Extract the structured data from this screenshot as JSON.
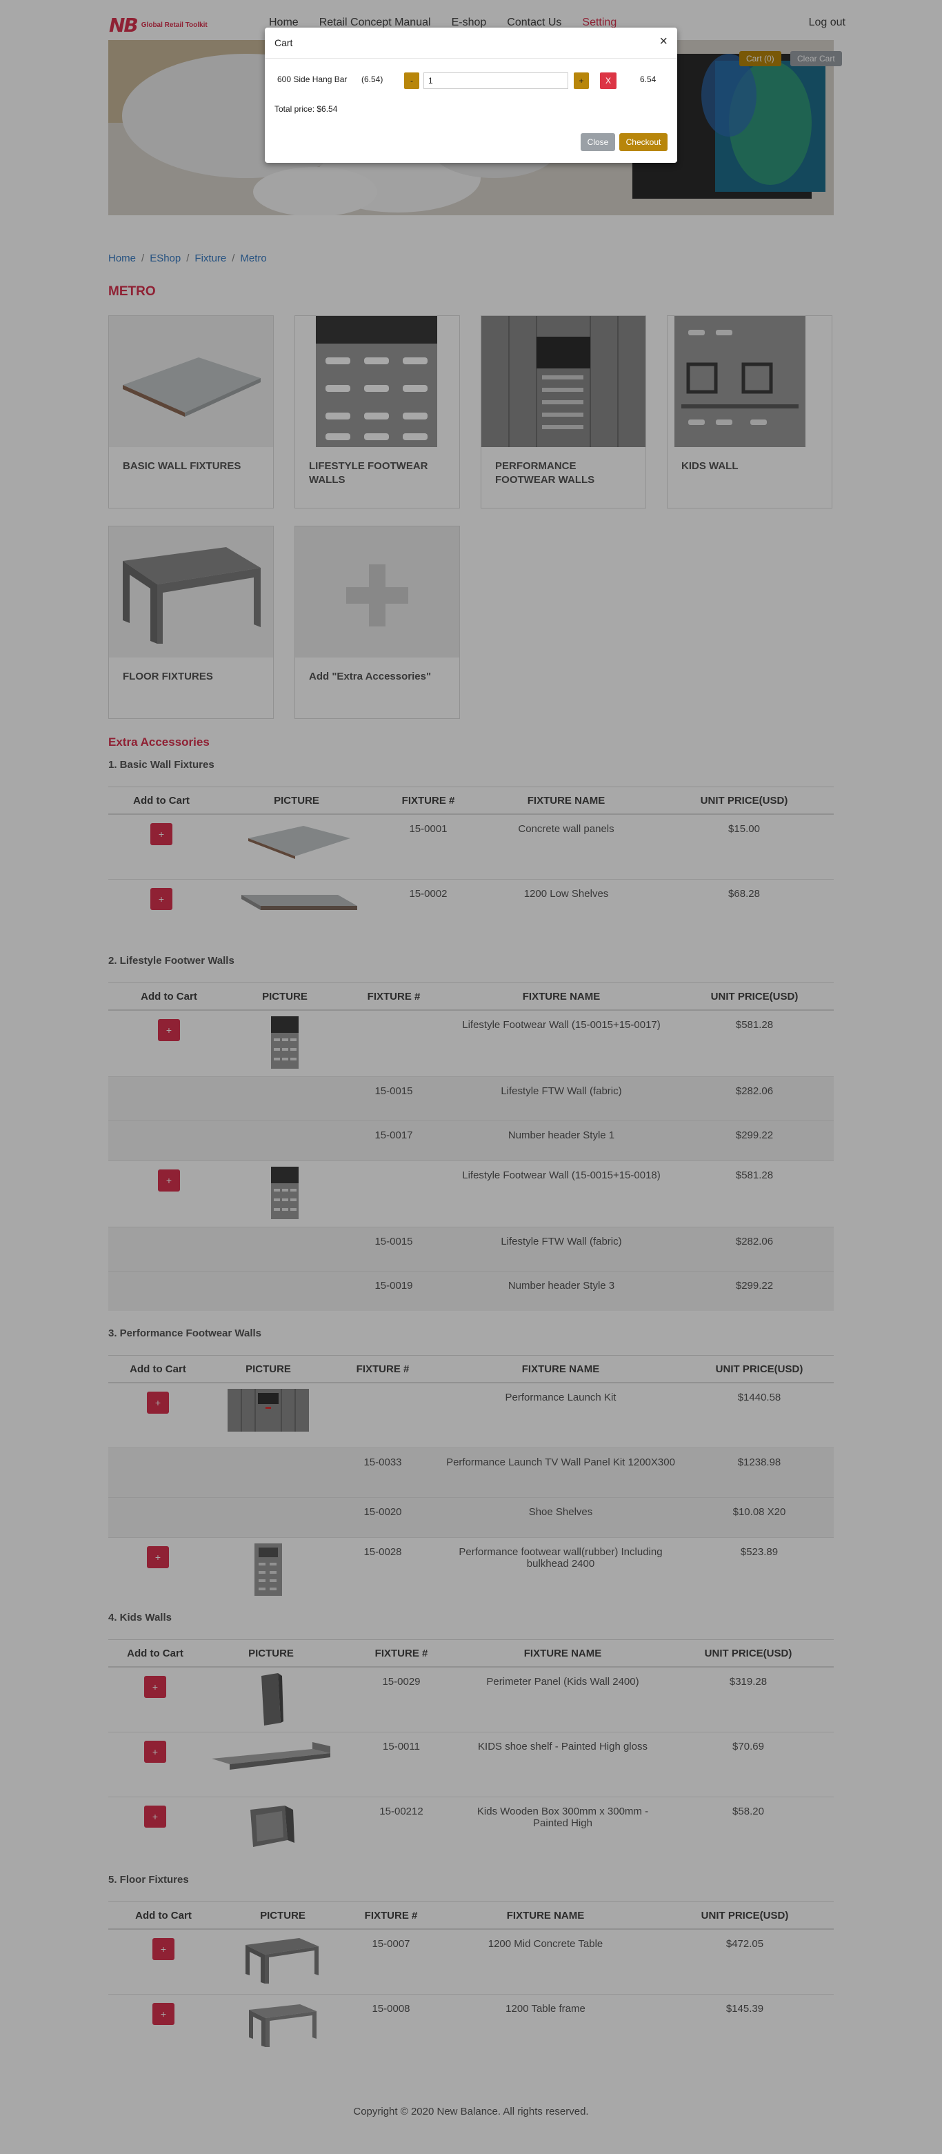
{
  "header": {
    "logo_mark": "NB",
    "logo_text": "Global Retail Toolkit",
    "nav": [
      "Home",
      "Retail Concept Manual",
      "E-shop",
      "Contact Us",
      "Setting"
    ],
    "logout": "Log out",
    "cart_button": "Cart (0)",
    "clear_cart_button": "Clear Cart"
  },
  "breadcrumb": [
    "Home",
    "EShop",
    "Fixture",
    "Metro"
  ],
  "category_title": "METRO",
  "cards": [
    {
      "label": "BASIC WALL FIXTURES"
    },
    {
      "label": "LIFESTYLE FOOTWEAR WALLS"
    },
    {
      "label": "PERFORMANCE FOOTWEAR WALLS"
    },
    {
      "label": "KIDS WALL"
    },
    {
      "label": "FLOOR FIXTURES"
    },
    {
      "label": "Add \"Extra Accessories\""
    }
  ],
  "extra_title": "Extra Accessories",
  "columns": {
    "add": "Add to Cart",
    "picture": "PICTURE",
    "fixture_no": "FIXTURE #",
    "fixture_name": "FIXTURE NAME",
    "price": "UNIT PRICE(USD)"
  },
  "add_symbol": "+",
  "sections": [
    {
      "title": "1. Basic Wall Fixtures",
      "rows": [
        {
          "no": "15-0001",
          "name": "Concrete wall panels",
          "price": "$15.00"
        },
        {
          "no": "15-0002",
          "name": "1200 Low Shelves",
          "price": "$68.28"
        }
      ]
    },
    {
      "title": "2. Lifestyle Footwer Walls",
      "rows": [
        {
          "no": "",
          "name": "Lifestyle Footwear Wall (15-0015+15-0017)",
          "price": "$581.28"
        },
        {
          "no": "15-0015",
          "name": "Lifestyle FTW Wall (fabric)",
          "price": "$282.06"
        },
        {
          "no": "15-0017",
          "name": "Number header Style 1",
          "price": "$299.22"
        },
        {
          "no": "",
          "name": "Lifestyle Footwear Wall (15-0015+15-0018)",
          "price": "$581.28"
        },
        {
          "no": "15-0015",
          "name": "Lifestyle FTW Wall (fabric)",
          "price": "$282.06"
        },
        {
          "no": "15-0019",
          "name": "Number header Style 3",
          "price": "$299.22"
        }
      ]
    },
    {
      "title": "3. Performance Footwear Walls",
      "rows": [
        {
          "no": "",
          "name": "Performance Launch Kit",
          "price": "$1440.58"
        },
        {
          "no": "15-0033",
          "name": "Performance Launch TV Wall Panel Kit 1200X300",
          "price": "$1238.98"
        },
        {
          "no": "15-0020",
          "name": "Shoe Shelves",
          "price": "$10.08 X20"
        },
        {
          "no": "15-0028",
          "name": "Performance footwear wall(rubber) Including bulkhead 2400",
          "price": "$523.89"
        }
      ]
    },
    {
      "title": "4. Kids Walls",
      "rows": [
        {
          "no": "15-0029",
          "name": "Perimeter Panel (Kids Wall 2400)",
          "price": "$319.28"
        },
        {
          "no": "15-0011",
          "name": "KIDS shoe shelf - Painted High gloss",
          "price": "$70.69"
        },
        {
          "no": "15-00212",
          "name": "Kids Wooden Box 300mm x 300mm - Painted High",
          "price": "$58.20"
        }
      ]
    },
    {
      "title": "5. Floor Fixtures",
      "rows": [
        {
          "no": "15-0007",
          "name": "1200 Mid Concrete Table",
          "price": "$472.05"
        },
        {
          "no": "15-0008",
          "name": "1200 Table frame",
          "price": "$145.39"
        }
      ]
    }
  ],
  "footer": "Copyright © 2020 New Balance. All rights reserved.",
  "cart_modal": {
    "title": "Cart",
    "close_symbol": "×",
    "item_name": "600 Side Hang Bar",
    "item_price": "(6.54)",
    "minus": "-",
    "quantity": "1",
    "plus": "+",
    "remove": "X",
    "line_total": "6.54",
    "total_text": "Total price: $6.54",
    "close_button": "Close",
    "checkout_button": "Checkout"
  },
  "colors": {
    "accent": "#d9334f",
    "gold": "#b8860b",
    "link": "#3b7dc4",
    "gray_button": "#9aa0a6"
  }
}
